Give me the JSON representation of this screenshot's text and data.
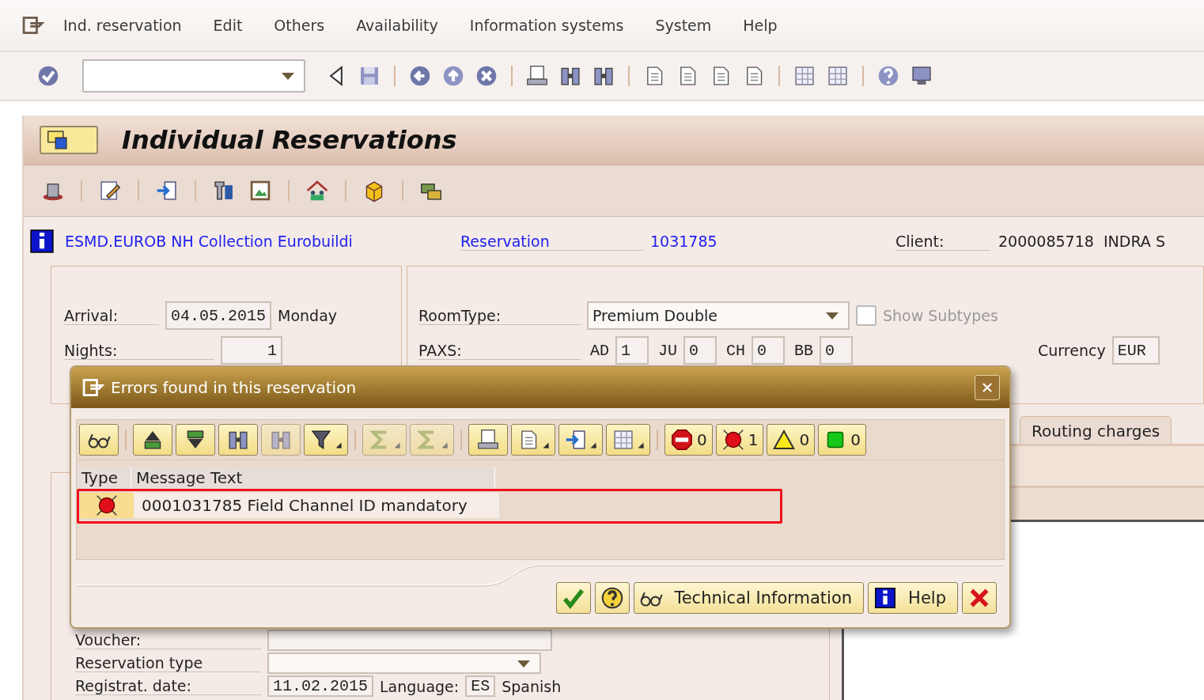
{
  "menu_bar": {
    "items": [
      "Ind. reservation",
      "Edit",
      "Others",
      "Availability",
      "Information systems",
      "System",
      "Help"
    ]
  },
  "title": "Individual Reservations",
  "header": {
    "hotel": "ESMD.EUROB NH Collection Eurobuildi",
    "reservation_label": "Reservation",
    "reservation_number": "1031785",
    "client_label": "Client:",
    "client_value": "2000085718  INDRA S"
  },
  "stay": {
    "arrival_label": "Arrival:",
    "arrival": "04.05.2015",
    "weekday": "Monday",
    "nights_label": "Nights:",
    "nights": "1"
  },
  "room": {
    "room_type_label": "RoomType:",
    "room_type": "Premium Double",
    "show_subtypes": {
      "label": "Show Subtypes",
      "checked": false,
      "disabled": true
    },
    "paxs_label": "PAXS:",
    "paxs": [
      {
        "code": "AD",
        "value": "1"
      },
      {
        "code": "JU",
        "value": "0"
      },
      {
        "code": "CH",
        "value": "0"
      },
      {
        "code": "BB",
        "value": "0"
      }
    ],
    "currency_label": "Currency",
    "currency": "EUR"
  },
  "tabs": [
    {
      "label": "Routing charges",
      "selected": false
    }
  ],
  "booking": {
    "voucher_label": "Voucher:",
    "reservation_type_label": "Reservation type",
    "registration_date_label": "Registrat. date:",
    "registration_date": "11.02.2015",
    "language_label": "Language:",
    "language": "ES",
    "language_name": "Spanish"
  },
  "dialog": {
    "title": "Errors found in this reservation",
    "counters": [
      {
        "kind": "stop",
        "count": "0"
      },
      {
        "kind": "error",
        "count": "1"
      },
      {
        "kind": "warning",
        "count": "0"
      },
      {
        "kind": "success",
        "count": "0"
      }
    ],
    "columns": [
      "Type",
      "Message Text"
    ],
    "messages": [
      {
        "kind": "error",
        "text": "0001031785 Field Channel ID mandatory",
        "highlighted": true
      }
    ],
    "buttons": [
      {
        "kind": "continue"
      },
      {
        "kind": "help"
      },
      {
        "kind": "technical",
        "label": "Technical Information"
      },
      {
        "kind": "info",
        "label": "Help"
      },
      {
        "kind": "cancel"
      }
    ]
  }
}
